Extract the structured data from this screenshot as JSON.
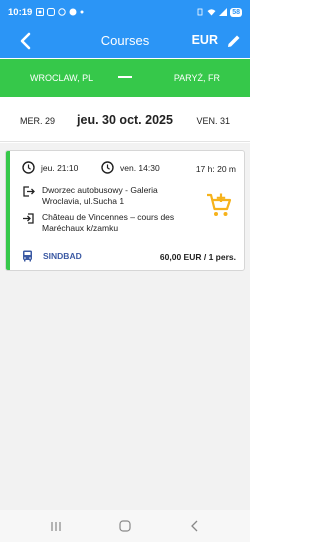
{
  "status_bar": {
    "time": "10:19",
    "battery": "58"
  },
  "header": {
    "title": "Courses",
    "currency": "EUR"
  },
  "route": {
    "from": "WROCLAW, PL",
    "to": "PARYŻ, FR"
  },
  "date_nav": {
    "prev": "MER. 29",
    "current": "jeu. 30 oct. 2025",
    "next": "VEN. 31"
  },
  "results": [
    {
      "departure_time": "jeu. 21:10",
      "arrival_time": "ven. 14:30",
      "duration": "17 h: 20 m",
      "departure_stop": "Dworzec autobusowy - Galeria Wroclavia, ul.Sucha 1",
      "arrival_stop": "Château de Vincennes – cours des Maréchaux k/zamku",
      "operator": "SINDBAD",
      "price": "60,00 EUR / 1 pers."
    }
  ],
  "colors": {
    "app_bar": "#2b95f6",
    "route_bar": "#36c84a",
    "cart": "#f6b21b",
    "operator": "#3b59a3"
  }
}
